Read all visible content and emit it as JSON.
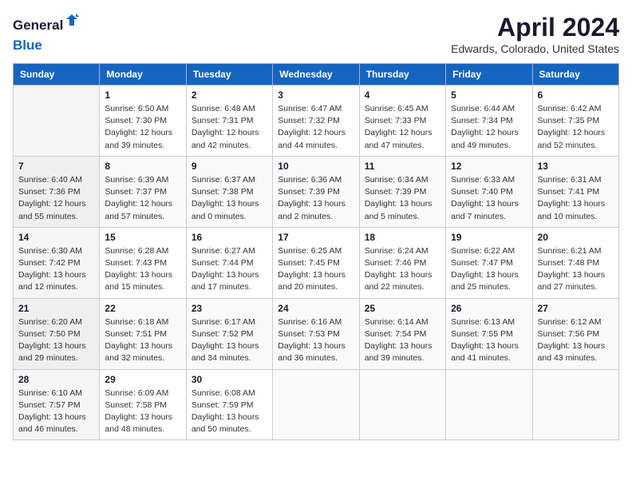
{
  "logo": {
    "general": "General",
    "blue": "Blue"
  },
  "title": "April 2024",
  "subtitle": "Edwards, Colorado, United States",
  "weekdays": [
    "Sunday",
    "Monday",
    "Tuesday",
    "Wednesday",
    "Thursday",
    "Friday",
    "Saturday"
  ],
  "weeks": [
    [
      {
        "num": "",
        "info": ""
      },
      {
        "num": "1",
        "info": "Sunrise: 6:50 AM\nSunset: 7:30 PM\nDaylight: 12 hours\nand 39 minutes."
      },
      {
        "num": "2",
        "info": "Sunrise: 6:48 AM\nSunset: 7:31 PM\nDaylight: 12 hours\nand 42 minutes."
      },
      {
        "num": "3",
        "info": "Sunrise: 6:47 AM\nSunset: 7:32 PM\nDaylight: 12 hours\nand 44 minutes."
      },
      {
        "num": "4",
        "info": "Sunrise: 6:45 AM\nSunset: 7:33 PM\nDaylight: 12 hours\nand 47 minutes."
      },
      {
        "num": "5",
        "info": "Sunrise: 6:44 AM\nSunset: 7:34 PM\nDaylight: 12 hours\nand 49 minutes."
      },
      {
        "num": "6",
        "info": "Sunrise: 6:42 AM\nSunset: 7:35 PM\nDaylight: 12 hours\nand 52 minutes."
      }
    ],
    [
      {
        "num": "7",
        "info": "Sunrise: 6:40 AM\nSunset: 7:36 PM\nDaylight: 12 hours\nand 55 minutes."
      },
      {
        "num": "8",
        "info": "Sunrise: 6:39 AM\nSunset: 7:37 PM\nDaylight: 12 hours\nand 57 minutes."
      },
      {
        "num": "9",
        "info": "Sunrise: 6:37 AM\nSunset: 7:38 PM\nDaylight: 13 hours\nand 0 minutes."
      },
      {
        "num": "10",
        "info": "Sunrise: 6:36 AM\nSunset: 7:39 PM\nDaylight: 13 hours\nand 2 minutes."
      },
      {
        "num": "11",
        "info": "Sunrise: 6:34 AM\nSunset: 7:39 PM\nDaylight: 13 hours\nand 5 minutes."
      },
      {
        "num": "12",
        "info": "Sunrise: 6:33 AM\nSunset: 7:40 PM\nDaylight: 13 hours\nand 7 minutes."
      },
      {
        "num": "13",
        "info": "Sunrise: 6:31 AM\nSunset: 7:41 PM\nDaylight: 13 hours\nand 10 minutes."
      }
    ],
    [
      {
        "num": "14",
        "info": "Sunrise: 6:30 AM\nSunset: 7:42 PM\nDaylight: 13 hours\nand 12 minutes."
      },
      {
        "num": "15",
        "info": "Sunrise: 6:28 AM\nSunset: 7:43 PM\nDaylight: 13 hours\nand 15 minutes."
      },
      {
        "num": "16",
        "info": "Sunrise: 6:27 AM\nSunset: 7:44 PM\nDaylight: 13 hours\nand 17 minutes."
      },
      {
        "num": "17",
        "info": "Sunrise: 6:25 AM\nSunset: 7:45 PM\nDaylight: 13 hours\nand 20 minutes."
      },
      {
        "num": "18",
        "info": "Sunrise: 6:24 AM\nSunset: 7:46 PM\nDaylight: 13 hours\nand 22 minutes."
      },
      {
        "num": "19",
        "info": "Sunrise: 6:22 AM\nSunset: 7:47 PM\nDaylight: 13 hours\nand 25 minutes."
      },
      {
        "num": "20",
        "info": "Sunrise: 6:21 AM\nSunset: 7:48 PM\nDaylight: 13 hours\nand 27 minutes."
      }
    ],
    [
      {
        "num": "21",
        "info": "Sunrise: 6:20 AM\nSunset: 7:50 PM\nDaylight: 13 hours\nand 29 minutes."
      },
      {
        "num": "22",
        "info": "Sunrise: 6:18 AM\nSunset: 7:51 PM\nDaylight: 13 hours\nand 32 minutes."
      },
      {
        "num": "23",
        "info": "Sunrise: 6:17 AM\nSunset: 7:52 PM\nDaylight: 13 hours\nand 34 minutes."
      },
      {
        "num": "24",
        "info": "Sunrise: 6:16 AM\nSunset: 7:53 PM\nDaylight: 13 hours\nand 36 minutes."
      },
      {
        "num": "25",
        "info": "Sunrise: 6:14 AM\nSunset: 7:54 PM\nDaylight: 13 hours\nand 39 minutes."
      },
      {
        "num": "26",
        "info": "Sunrise: 6:13 AM\nSunset: 7:55 PM\nDaylight: 13 hours\nand 41 minutes."
      },
      {
        "num": "27",
        "info": "Sunrise: 6:12 AM\nSunset: 7:56 PM\nDaylight: 13 hours\nand 43 minutes."
      }
    ],
    [
      {
        "num": "28",
        "info": "Sunrise: 6:10 AM\nSunset: 7:57 PM\nDaylight: 13 hours\nand 46 minutes."
      },
      {
        "num": "29",
        "info": "Sunrise: 6:09 AM\nSunset: 7:58 PM\nDaylight: 13 hours\nand 48 minutes."
      },
      {
        "num": "30",
        "info": "Sunrise: 6:08 AM\nSunset: 7:59 PM\nDaylight: 13 hours\nand 50 minutes."
      },
      {
        "num": "",
        "info": ""
      },
      {
        "num": "",
        "info": ""
      },
      {
        "num": "",
        "info": ""
      },
      {
        "num": "",
        "info": ""
      }
    ]
  ]
}
